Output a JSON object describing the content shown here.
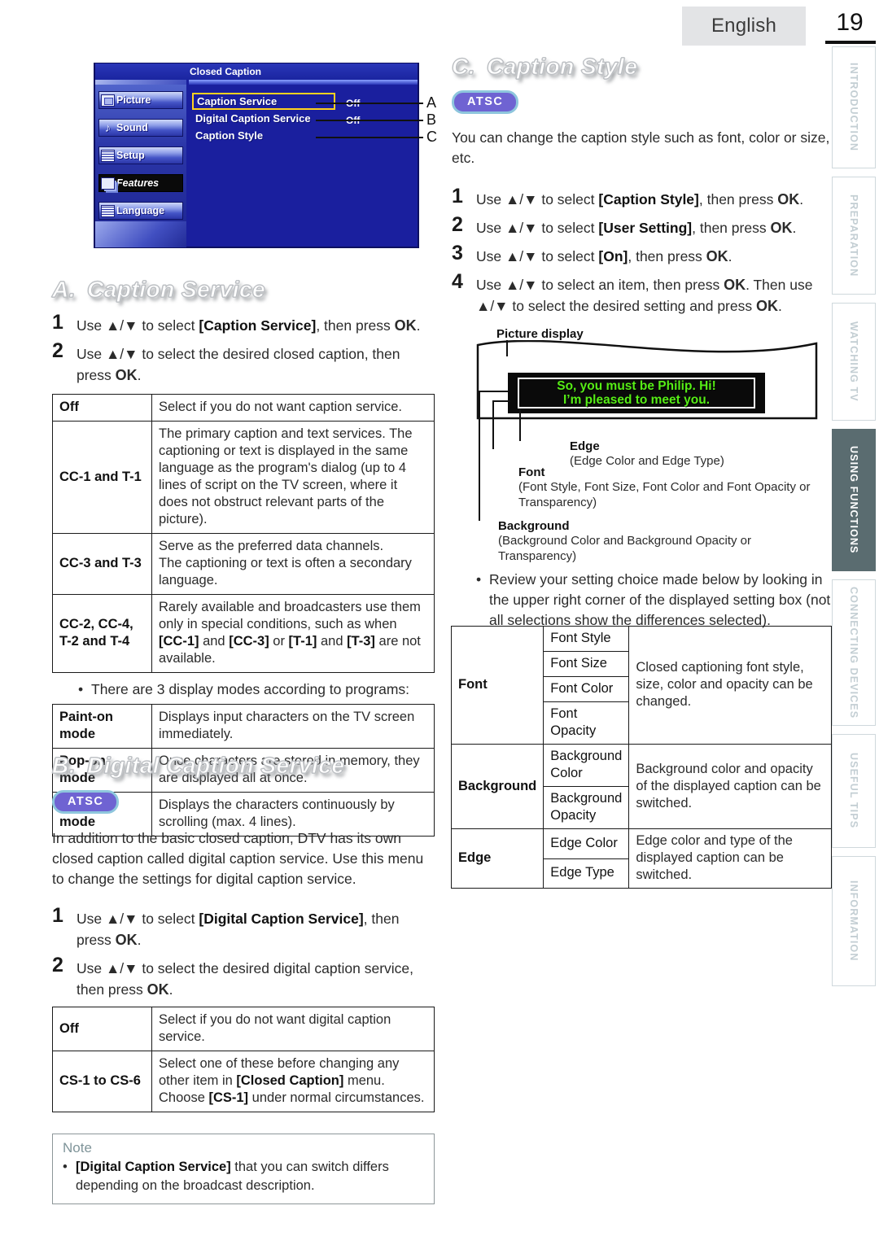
{
  "header": {
    "language": "English",
    "page_number": "19"
  },
  "side_tabs": [
    {
      "label": "INTRODUCTION",
      "active": false
    },
    {
      "label": "PREPARATION",
      "active": false
    },
    {
      "label": "WATCHING TV",
      "active": false
    },
    {
      "label": "USING FUNCTIONS",
      "active": true
    },
    {
      "label": "CONNECTING DEVICES",
      "active": false
    },
    {
      "label": "USEFUL TIPS",
      "active": false
    },
    {
      "label": "INFORMATION",
      "active": false
    }
  ],
  "tv_menu": {
    "title": "Closed Caption",
    "sidebar": [
      {
        "label": "Picture",
        "icon": "picture-icon",
        "selected": false
      },
      {
        "label": "Sound",
        "icon": "sound-icon",
        "selected": false
      },
      {
        "label": "Setup",
        "icon": "setup-icon",
        "selected": false
      },
      {
        "label": "Features",
        "icon": "features-icon",
        "selected": true
      },
      {
        "label": "Language",
        "icon": "language-icon",
        "selected": false
      }
    ],
    "rows": [
      {
        "label": "Caption Service",
        "value": "Off",
        "callout": "A",
        "highlighted": true
      },
      {
        "label": "Digital Caption Service",
        "value": "Off",
        "callout": "B",
        "highlighted": false
      },
      {
        "label": "Caption Style",
        "value": "",
        "callout": "C",
        "highlighted": false
      }
    ]
  },
  "section_a": {
    "letter": "A.",
    "title": "Caption Service",
    "steps": [
      {
        "num": "1",
        "text": "Use ▲/▼ to select [Caption Service], then press OK."
      },
      {
        "num": "2",
        "text": "Use ▲/▼ to select the desired closed caption, then press OK."
      }
    ],
    "table": [
      {
        "key": "Off",
        "desc": "Select if you do not want caption service."
      },
      {
        "key": "CC-1 and T-1",
        "desc": "The primary caption and text services. The captioning or text is displayed in the same language as the program's dialog (up to 4 lines of script on the TV screen, where it does not obstruct relevant parts of the picture)."
      },
      {
        "key": "CC-3 and T-3",
        "desc": "Serve as the preferred data channels.\nThe captioning or text is often a secondary language."
      },
      {
        "key": "CC-2, CC-4, T-2 and T-4",
        "desc": "Rarely available and broadcasters use them only in special conditions, such as when [CC-1] and [CC-3] or [T-1] and [T-3] are not available."
      }
    ],
    "modes_bullet": "There are 3 display modes according to programs:",
    "modes_table": [
      {
        "key": "Paint-on mode",
        "desc": "Displays input characters on the TV screen immediately."
      },
      {
        "key": "Pop-on mode",
        "desc": "Once characters are stored in memory, they are displayed all at once."
      },
      {
        "key": "Roll-up mode",
        "desc": "Displays the characters continuously by scrolling (max. 4 lines)."
      }
    ]
  },
  "section_b": {
    "letter": "B.",
    "title": "Digital Caption Service",
    "badge": "ATSC",
    "intro": "In addition to the basic closed caption, DTV has its own closed caption called digital caption service. Use this menu to change the settings for digital caption service.",
    "steps": [
      {
        "num": "1",
        "text": "Use ▲/▼ to select [Digital Caption Service], then press OK."
      },
      {
        "num": "2",
        "text": "Use ▲/▼ to select the desired digital caption service, then press OK."
      }
    ],
    "table": [
      {
        "key": "Off",
        "desc": "Select if you do not want digital caption service."
      },
      {
        "key": "CS-1 to CS-6",
        "desc": "Select one of these before changing any other item in [Closed Caption] menu. Choose [CS-1] under normal circumstances."
      }
    ],
    "note": {
      "title": "Note",
      "text": "[Digital Caption Service] that you can switch differs depending on the broadcast description."
    }
  },
  "section_c": {
    "letter": "C.",
    "title": "Caption Style",
    "badge": "ATSC",
    "intro": "You can change the caption style such as font, color or size, etc.",
    "steps": [
      {
        "num": "1",
        "text": "Use ▲/▼ to select [Caption Style], then press OK."
      },
      {
        "num": "2",
        "text": "Use ▲/▼ to select [User Setting], then press OK."
      },
      {
        "num": "3",
        "text": "Use ▲/▼ to select [On], then press OK."
      },
      {
        "num": "4",
        "text": "Use ▲/▼ to select an item, then press OK. Then use ▲/▼ to select the desired setting and press OK."
      }
    ],
    "diagram": {
      "picture_display_label": "Picture display",
      "caption_line_1": "So, you must be Philip. Hi!",
      "caption_line_2": "I’m pleased to meet you.",
      "caption_color": "#56ed16",
      "labels": [
        {
          "name": "Edge",
          "detail": "(Edge Color and Edge Type)"
        },
        {
          "name": "Font",
          "detail": "(Font Style, Font Size, Font Color and Font Opacity or Transparency)"
        },
        {
          "name": "Background",
          "detail": "(Background Color and Background Opacity or Transparency)"
        }
      ]
    },
    "review_bullet": "Review your setting choice made below by looking in the upper right corner of the displayed setting box (not all selections show the differences selected).",
    "style_table": [
      {
        "category": "Font",
        "items": [
          "Font Style",
          "Font Size",
          "Font Color",
          "Font Opacity"
        ],
        "desc": "Closed captioning font style, size, color and opacity can be changed."
      },
      {
        "category": "Background",
        "items": [
          "Background Color",
          "Background Opacity"
        ],
        "desc": "Background color and opacity of the displayed caption can be switched."
      },
      {
        "category": "Edge",
        "items": [
          "Edge Color",
          "Edge Type"
        ],
        "desc": "Edge color and type of the displayed caption can be switched."
      }
    ]
  }
}
